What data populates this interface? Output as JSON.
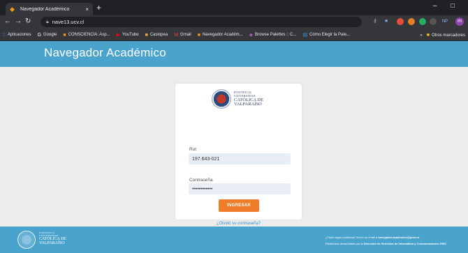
{
  "browser": {
    "tab_title": "Navegador Académico",
    "tab_close": "×",
    "new_tab": "+",
    "url": "nave13.ucv.cl",
    "win_minimize": "–",
    "win_maximize": "□",
    "profile_initial": "m",
    "bookmarks": [
      {
        "label": "Aplicaciones",
        "icon": "apps-icon",
        "color": "#4285f4"
      },
      {
        "label": "Google",
        "icon": "google-icon",
        "color": "#ffffff"
      },
      {
        "label": "CONSCIENCIA: Asp...",
        "icon": "bookmark-icon",
        "color": "#f39c12"
      },
      {
        "label": "YouTube",
        "icon": "youtube-icon",
        "color": "#ff0000"
      },
      {
        "label": "Casiopea",
        "icon": "bookmark-icon",
        "color": "#f5b041"
      },
      {
        "label": "Gmail",
        "icon": "gmail-icon",
        "color": "#ea4335"
      },
      {
        "label": "Navegador Académ...",
        "icon": "bookmark-icon",
        "color": "#f39c12"
      },
      {
        "label": "Browse Palettes :: C...",
        "icon": "palette-icon",
        "color": "#9b59b6"
      },
      {
        "label": "Cómo Elegir la Pale...",
        "icon": "doc-icon",
        "color": "#3498db"
      }
    ],
    "bookmarks_overflow": "»",
    "other_bookmarks": "Otros marcadores"
  },
  "site": {
    "title": "Navegador Académico",
    "header_color": "#4aa3cc"
  },
  "login": {
    "logo": {
      "line1": "PONTIFICIA",
      "line2": "UNIVERSIDAD",
      "line3": "CATÓLICA DE",
      "line4": "VALPARAÍSO"
    },
    "rut_label": "Rut",
    "rut_value": "197.643-021",
    "password_label": "Contraseña",
    "password_value": "••••••••••••",
    "submit_label": "INGRESAR",
    "forgot_label": "¿Olvidó su contraseña?",
    "accent_color": "#f07d2a"
  },
  "footer": {
    "logo": {
      "line1": "PONTIFICIA",
      "line2": "UNIVERSIDAD",
      "line3": "CATÓLICA DE",
      "line4": "VALPARAÍSO"
    },
    "help_prefix": "¿Tiene algún problema? Envíe un email a ",
    "help_email": "navegador.academico@pucv.cl",
    "credit_prefix": "Plataforma desarrollada por la ",
    "credit_org": "Dirección de Servicios de Informática y Comunicaciones DSIC"
  }
}
